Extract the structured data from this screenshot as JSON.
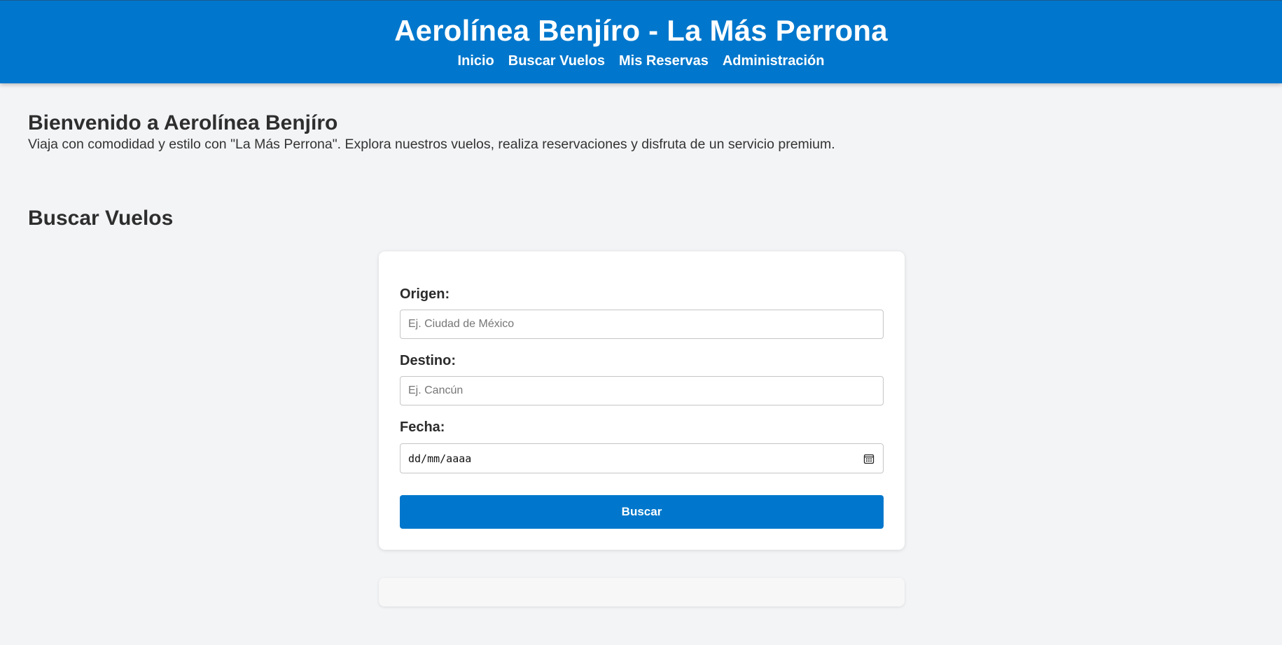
{
  "header": {
    "title": "Aerolínea Benjíro - La Más Perrona",
    "nav": [
      "Inicio",
      "Buscar Vuelos",
      "Mis Reservas",
      "Administración"
    ]
  },
  "welcome": {
    "heading": "Bienvenido a Aerolínea Benjíro",
    "text": "Viaja con comodidad y estilo con \"La Más Perrona\". Explora nuestros vuelos, realiza reservaciones y disfruta de un servicio premium."
  },
  "search": {
    "title": "Buscar Vuelos",
    "origin_label": "Origen:",
    "origin_placeholder": "Ej. Ciudad de México",
    "destination_label": "Destino:",
    "destination_placeholder": "Ej. Cancún",
    "date_label": "Fecha:",
    "date_placeholder": "dd/mm/aaaa",
    "button_label": "Buscar"
  },
  "icons": {
    "date_icon": "calendar-icon"
  },
  "colors": {
    "primary": "#0077cc",
    "background": "#f3f4f6",
    "card": "#ffffff"
  }
}
